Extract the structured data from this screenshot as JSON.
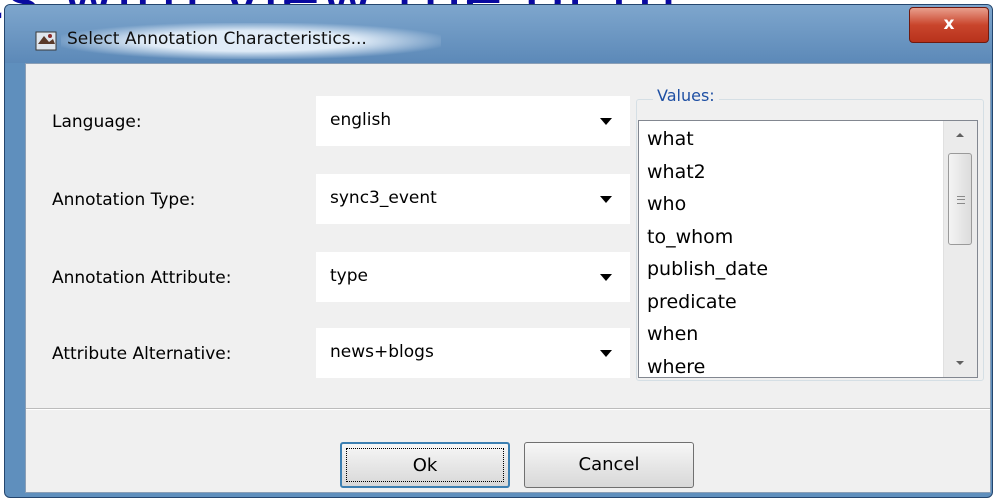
{
  "background_text": "cs with view the of th...",
  "dialog": {
    "title": "Select Annotation Characteristics...",
    "close_label": "x"
  },
  "form": {
    "fields": [
      {
        "label": "Language:",
        "value": "english"
      },
      {
        "label": "Annotation Type:",
        "value": "sync3_event"
      },
      {
        "label": "Annotation Attribute:",
        "value": "type"
      },
      {
        "label": "Attribute Alternative:",
        "value": "news+blogs"
      }
    ]
  },
  "values_group": {
    "title": "Values:",
    "items": [
      "what",
      "what2",
      "who",
      "to_whom",
      "publish_date",
      "predicate",
      "when",
      "where"
    ]
  },
  "buttons": {
    "ok": "Ok",
    "cancel": "Cancel"
  },
  "colors": {
    "frame": "#5f8fbd",
    "close": "#c9452c",
    "group_title": "#1e4fa3"
  }
}
